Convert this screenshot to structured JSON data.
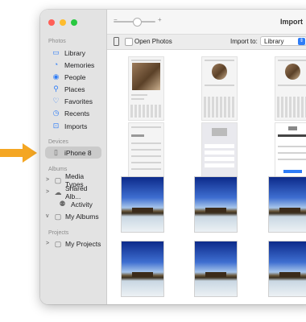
{
  "window": {
    "title": "Import"
  },
  "sidebar": {
    "sections": [
      {
        "label": "Photos"
      },
      {
        "label": "Devices"
      },
      {
        "label": "Albums"
      },
      {
        "label": "Projects"
      }
    ],
    "photos_items": [
      {
        "label": "Library",
        "icon": "library-icon"
      },
      {
        "label": "Memories",
        "icon": "memories-icon"
      },
      {
        "label": "People",
        "icon": "people-icon"
      },
      {
        "label": "Places",
        "icon": "places-icon"
      },
      {
        "label": "Favorites",
        "icon": "heart-icon"
      },
      {
        "label": "Recents",
        "icon": "clock-icon"
      },
      {
        "label": "Imports",
        "icon": "import-icon"
      }
    ],
    "device_items": [
      {
        "label": "iPhone 8",
        "icon": "iphone-icon",
        "selected": true
      }
    ],
    "album_items": [
      {
        "label": "Media Types",
        "icon": "folder-icon",
        "chevron": ">"
      },
      {
        "label": "Shared Alb...",
        "icon": "cloud-icon",
        "chevron": ">"
      },
      {
        "label": "Activity",
        "icon": "people-icon",
        "chevron": ""
      },
      {
        "label": "My Albums",
        "icon": "folder-icon",
        "chevron": "v"
      }
    ],
    "project_items": [
      {
        "label": "My Projects",
        "icon": "folder-icon",
        "chevron": ">"
      }
    ]
  },
  "toolbar": {
    "open_photos_label": "Open Photos",
    "import_to_label": "Import to:",
    "import_to_value": "Library"
  },
  "grid": {
    "rows": [
      {
        "type": "screenshot"
      },
      {
        "type": "screenshot"
      },
      {
        "type": "beach"
      },
      {
        "type": "beach"
      }
    ]
  },
  "colors": {
    "accent": "#2f7df7",
    "pointer": "#f4a623",
    "traffic_close": "#ff5f57",
    "traffic_min": "#febc2e",
    "traffic_max": "#28c840"
  }
}
